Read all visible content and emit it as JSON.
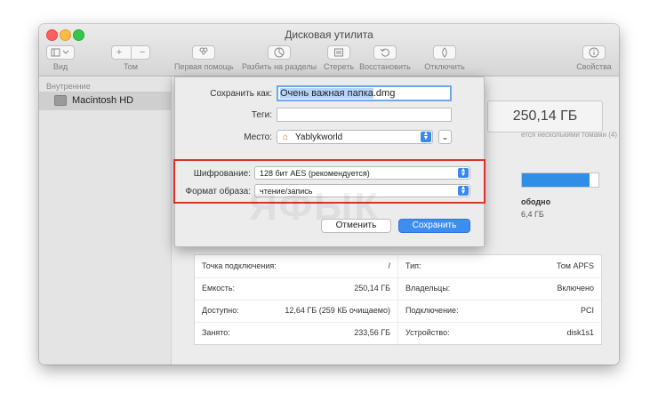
{
  "window": {
    "title": "Дисковая утилита"
  },
  "toolbar": {
    "view_label": "Вид",
    "volume_label": "Том",
    "first_aid_label": "Первая помощь",
    "partition_label": "Разбить на разделы",
    "erase_label": "Стереть",
    "restore_label": "Восстановить",
    "unmount_label": "Отключить",
    "info_label": "Свойства"
  },
  "sidebar": {
    "section": "Внутренние",
    "items": [
      {
        "label": "Macintosh HD"
      }
    ]
  },
  "volume": {
    "capacity": "250,14 ГБ",
    "shared_note": "ется несколькими томами (4)",
    "free_label": "ободно",
    "free_value": "6,4 ГБ",
    "used_fraction": 0.88
  },
  "info": {
    "left": [
      {
        "key": "Точка подключения:",
        "value": "/"
      },
      {
        "key": "Емкость:",
        "value": "250,14 ГБ"
      },
      {
        "key": "Доступно:",
        "value": "12,64 ГБ (259 КБ очищаемо)"
      },
      {
        "key": "Занято:",
        "value": "233,56 ГБ"
      }
    ],
    "right": [
      {
        "key": "Тип:",
        "value": "Том APFS"
      },
      {
        "key": "Владельцы:",
        "value": "Включено"
      },
      {
        "key": "Подключение:",
        "value": "PCI"
      },
      {
        "key": "Устройство:",
        "value": "disk1s1"
      }
    ]
  },
  "save_sheet": {
    "save_as_label": "Сохранить как:",
    "filename_selected": "Очень важная папка",
    "filename_ext": ".dmg",
    "tags_label": "Теги:",
    "tags_value": "",
    "where_label": "Место:",
    "where_value": "Yablykworld",
    "encryption_label": "Шифрование:",
    "encryption_value": "128 бит AES (рекомендуется)",
    "format_label": "Формат образа:",
    "format_value": "чтение/запись",
    "cancel_label": "Отменить",
    "save_label": "Сохранить"
  },
  "watermark": "ЯФЫК"
}
